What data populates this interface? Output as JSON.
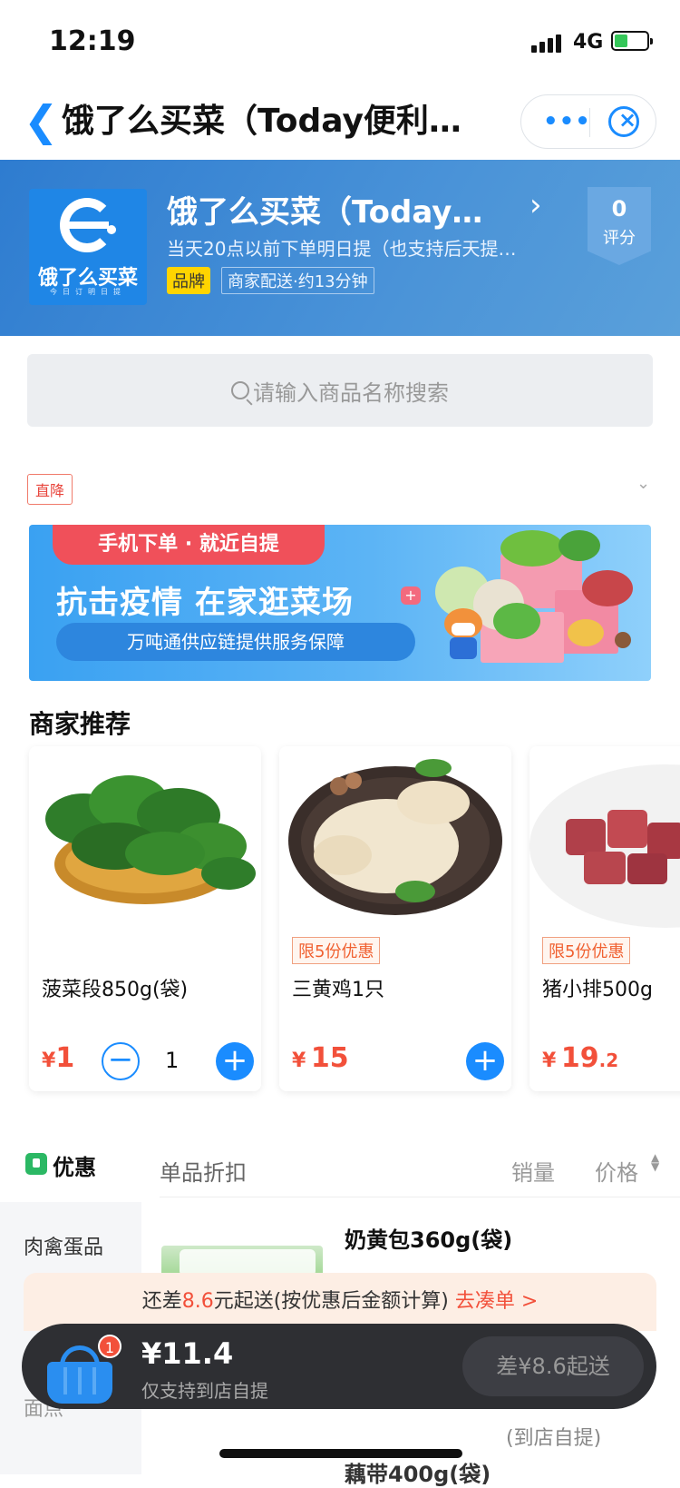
{
  "status_bar": {
    "time": "12:19",
    "network": "4G"
  },
  "nav": {
    "title": "饿了么买菜（Today便利…",
    "more_icon": "more-dots-icon",
    "close_icon": "close-miniprogram-icon"
  },
  "store": {
    "logo_text": "饿了么买菜",
    "logo_sub": "今日订明日提",
    "name": "饿了么买菜（Today…",
    "desc": "当天20点以前下单明日提（也支持后天提…",
    "brand_tag": "品牌",
    "delivery": "商家配送·约13分钟",
    "rating_value": "0",
    "rating_label": "评分"
  },
  "search": {
    "placeholder": "请输入商品名称搜索"
  },
  "promo_tag": "直降",
  "banner": {
    "pill": "手机下单 · 就近自提",
    "headline": "抗击疫情  在家逛菜场",
    "sub": "万吨通供应链提供服务保障"
  },
  "recommend": {
    "title": "商家推荐",
    "items": [
      {
        "name": "菠菜段850g(袋)",
        "price_symbol": "¥",
        "price_int": "1",
        "price_dec": "",
        "qty": "1",
        "limit": ""
      },
      {
        "name": "三黄鸡1只",
        "price_symbol": "¥",
        "price_int": "15",
        "price_dec": "",
        "limit": "限5份优惠"
      },
      {
        "name": "猪小排500g",
        "price_symbol": "¥",
        "price_int": "19",
        "price_dec": ".2",
        "limit": "限5份优惠"
      }
    ]
  },
  "menu": {
    "discount_label": "优惠",
    "sidebar": [
      "肉禽蛋品",
      "面点"
    ],
    "section_title": "单品折扣",
    "sort_sales": "销量",
    "sort_price": "价格",
    "products": [
      {
        "name": "奶黄包360g(袋)"
      },
      {
        "name": "藕带400g(袋)"
      }
    ],
    "pickup_text": "(到店自提)"
  },
  "min_order": {
    "prefix": "还差",
    "amount": "8.6",
    "suffix": "元起送(按优惠后金额计算)",
    "link": "去凑单 >"
  },
  "cart": {
    "badge": "1",
    "total": "¥11.4",
    "note": "仅支持到店自提",
    "checkout": "差¥8.6起送"
  },
  "colors": {
    "accent": "#1a8cff",
    "price": "#f2503a",
    "header": "#2e7cd0",
    "cart_bar": "#2e2f33"
  }
}
